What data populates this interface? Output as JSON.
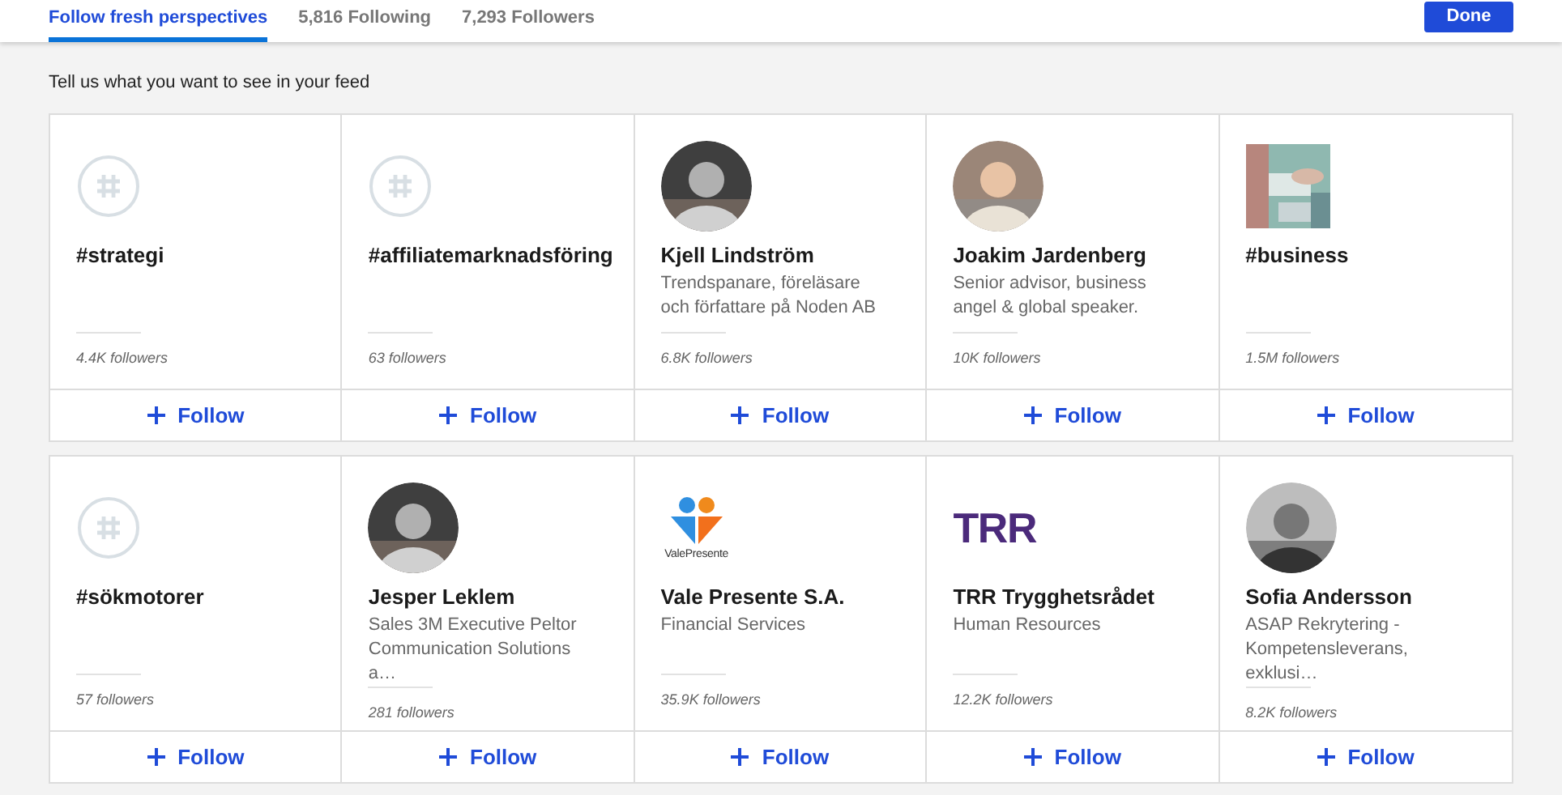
{
  "tabs": [
    {
      "label": "Follow fresh perspectives",
      "selected": true
    },
    {
      "label": "5,816 Following",
      "selected": false
    },
    {
      "label": "7,293 Followers",
      "selected": false
    }
  ],
  "done_button": "Done",
  "prompt": "Tell us what you want to see in your feed",
  "cards": [
    {
      "avatar": {
        "kind": "hashtag"
      },
      "name": "#strategi",
      "followers": "4.4K followers",
      "follow": "Follow"
    },
    {
      "avatar": {
        "kind": "hashtag"
      },
      "name": "#affiliatemarknadsföring",
      "followers": "63 followers",
      "follow": "Follow"
    },
    {
      "name": "Kjell Lindström",
      "description": "Trendspanare, föreläsare och författare på Noden AB",
      "followers": "6.8K followers",
      "follow": "Follow"
    },
    {
      "name": "Joakim Jardenberg",
      "description": "Senior advisor, business angel & global speaker.",
      "followers": "10K followers",
      "follow": "Follow"
    },
    {
      "avatar": {
        "kind": "square_photo"
      },
      "name": "#business",
      "followers": "1.5M followers",
      "follow": "Follow"
    },
    {
      "avatar": {
        "kind": "hashtag"
      },
      "name": "#sökmotorer",
      "followers": "57 followers",
      "follow": "Follow"
    },
    {
      "name": "Jesper Leklem",
      "description": "Sales 3M Executive Peltor Communication Solutions a…",
      "followers": "281 followers",
      "follow": "Follow"
    },
    {
      "avatar": {
        "kind": "people_logo",
        "text": "ValePresente"
      },
      "name": "Vale Presente S.A.",
      "description": "Financial Services",
      "followers": "35.9K followers",
      "follow": "Follow"
    },
    {
      "avatar": {
        "kind": "wordmark",
        "text": "TRR"
      },
      "name": "TRR Trygghetsrådet",
      "description": "Human Resources",
      "followers": "12.2K followers",
      "follow": "Follow"
    },
    {
      "name": "Sofia Andersson",
      "description": "ASAP Rekrytering - Kompetensleverans, exklusi…",
      "followers": "8.2K followers",
      "follow": "Follow"
    }
  ]
}
